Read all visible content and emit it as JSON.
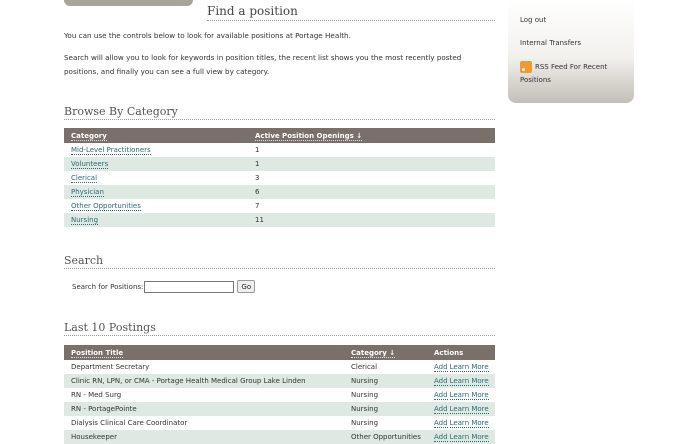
{
  "page": {
    "title": "Find a position",
    "intro": [
      "You can use the controls below to look for available positions at Portage Health.",
      "Search will allow you to look for keywords in position titles, the recent list shows you the most recently posted positions, and finally you can see a full view by category."
    ]
  },
  "browse": {
    "title": "Browse By Category",
    "columns": [
      "Category",
      "Active Position Openings ↓"
    ],
    "rows": [
      {
        "category": "Mid-Level Practitioners",
        "count": "1"
      },
      {
        "category": "Volunteers",
        "count": "1"
      },
      {
        "category": "Clerical",
        "count": "3"
      },
      {
        "category": "Physician",
        "count": "6"
      },
      {
        "category": "Other Opportunities",
        "count": "7"
      },
      {
        "category": "Nursing",
        "count": "11"
      }
    ]
  },
  "search": {
    "title": "Search",
    "label": "Search for Positions:",
    "value": "",
    "button": "Go"
  },
  "postings": {
    "title": "Last 10 Postings",
    "columns": [
      "Position Title",
      "Category ↓",
      "Actions"
    ],
    "rows": [
      {
        "title": "Department Secretary",
        "category": "Clerical"
      },
      {
        "title": "Clinic RN, LPN, or CMA - Portage Health Medical Group Lake Linden",
        "category": "Nursing"
      },
      {
        "title": "RN - Med Surg",
        "category": "Nursing"
      },
      {
        "title": "RN - PortagePointe",
        "category": "Nursing"
      },
      {
        "title": "Dialysis Clinical Care Coordinator",
        "category": "Nursing"
      },
      {
        "title": "Housekeeper",
        "category": "Other Opportunities"
      }
    ],
    "action_add": "Add",
    "action_learn": "Learn More"
  },
  "sidebar": {
    "items": [
      "Log out",
      "Internal Transfers"
    ],
    "rss_label_1": "RSS Feed For Recent",
    "rss_label_2": "Positions",
    "rss_icon": "rss-icon"
  },
  "colors": {
    "header_bg": "#7a6f69",
    "row_alt": "#dde9e2",
    "link": "#2d6a75",
    "rss": "#f29a2e"
  }
}
